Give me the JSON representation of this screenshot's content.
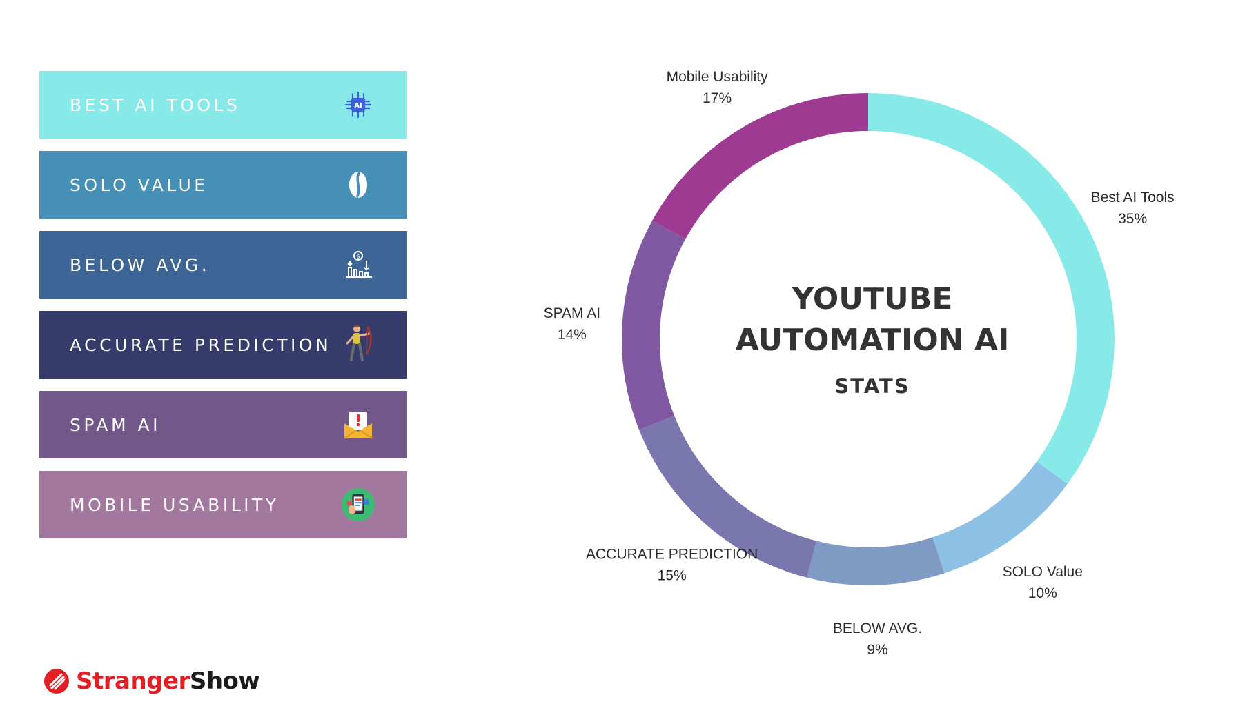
{
  "legend": [
    {
      "label": "BEST AI TOOLS",
      "color": "#88eae8",
      "icon": "ai-chip-icon"
    },
    {
      "label": "SOLO VALUE",
      "color": "#4690b8",
      "icon": "coffee-bean-icon"
    },
    {
      "label": "BELOW AVG.",
      "color": "#3d6696",
      "icon": "declining-chart-icon"
    },
    {
      "label": "ACCURATE PREDICTION",
      "color": "#353b6a",
      "icon": "archer-icon"
    },
    {
      "label": "SPAM AI",
      "color": "#725888",
      "icon": "spam-mail-icon"
    },
    {
      "label": "MOBILE USABILITY",
      "color": "#a3789e",
      "icon": "mobile-phone-icon"
    }
  ],
  "chart_data": {
    "type": "pie",
    "variant": "donut",
    "center_title_lines": [
      "YOUTUBE",
      "AUTOMATION AI"
    ],
    "center_subtitle": "STATS",
    "slices": [
      {
        "name": "Best AI Tools",
        "value": 35,
        "label_value": "35%",
        "color": "#88eae8"
      },
      {
        "name": "SOLO Value",
        "value": 10,
        "label_value": "10%",
        "color": "#8cc0e5"
      },
      {
        "name": "BELOW AVG.",
        "value": 9,
        "label_value": "9%",
        "color": "#7f9ac3"
      },
      {
        "name": "ACCURATE PREDICTION",
        "value": 15,
        "label_value": "15%",
        "color": "#7a76ae"
      },
      {
        "name": "SPAM AI",
        "value": 14,
        "label_value": "14%",
        "color": "#8159a2"
      },
      {
        "name": "Mobile Usability",
        "value": 17,
        "label_value": "17%",
        "color": "#9e3a92"
      }
    ]
  },
  "brand": {
    "part1": "Stranger",
    "part2": "Show",
    "color1": "#e31e24",
    "color2": "#1b1b1b"
  }
}
